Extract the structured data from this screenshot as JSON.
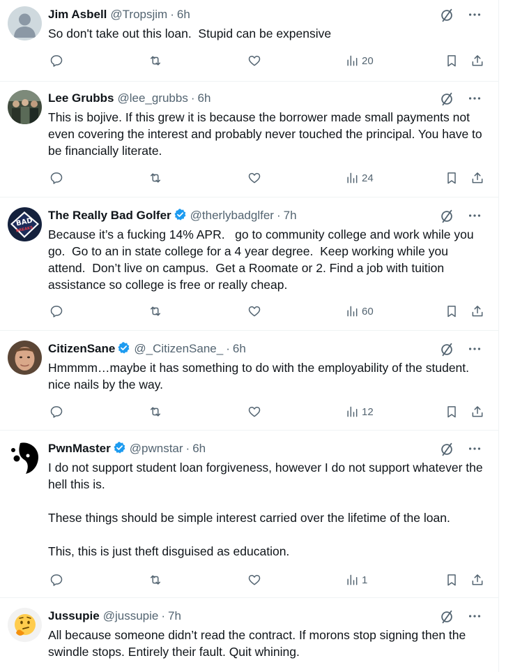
{
  "tweets": [
    {
      "name": "Jim Asbell",
      "handle": "@Tropsjim",
      "sep": "·",
      "time": "6h",
      "verified": false,
      "avatar": "default-avatar",
      "text": "So don't take out this loan.  Stupid can be expensive",
      "views": "20"
    },
    {
      "name": "Lee Grubbs",
      "handle": "@lee_grubbs",
      "sep": "·",
      "time": "6h",
      "verified": false,
      "avatar": "group-photo-avatar",
      "text": "This is bojive. If this grew it is because the borrower made small payments not even covering the interest and probably never touched the principal. You have to be financially literate.",
      "views": "24"
    },
    {
      "name": "The Really Bad Golfer",
      "handle": "@therlybadglfer",
      "sep": "·",
      "time": "7h",
      "verified": true,
      "avatar": "bad-breaks-logo-avatar",
      "avatar_text": [
        "BAD",
        "BREAKS"
      ],
      "text": "Because it’s a fucking 14% APR.   go to community college and work while you go.  Go to an in state college for a 4 year degree.  Keep working while you attend.  Don’t live on campus.  Get a Roomate or 2. Find a job with tuition assistance so college is free or really cheap.",
      "views": "60"
    },
    {
      "name": "CitizenSane",
      "handle": "@_CitizenSane_",
      "sep": "·",
      "time": "6h",
      "verified": true,
      "avatar": "face-photo-avatar",
      "text": "Hmmmm…maybe it has something to do with the employability of the student.  nice nails by the way.",
      "views": "12"
    },
    {
      "name": "PwnMaster",
      "handle": "@pwnstar",
      "sep": "·",
      "time": "6h",
      "verified": true,
      "avatar": "silhouette-avatar",
      "text": "I do not support student loan forgiveness, however I do not support whatever the hell this is.\n\nThese things should be simple interest carried over the lifetime of the loan.\n\nThis, this is just theft disguised as education.",
      "views": "1"
    },
    {
      "name": "Jussupie",
      "handle": "@jussupie",
      "sep": "·",
      "time": "7h",
      "verified": false,
      "avatar": "thinking-emoji-avatar",
      "text": "All because someone didn’t read the contract. If morons stop signing then the swindle stops. Entirely their fault. Quit whining.",
      "views": ""
    }
  ],
  "colors": {
    "text": "#0f1419",
    "secondary": "#536471",
    "verified": "#1d9bf0",
    "divider": "#eff3f4"
  }
}
